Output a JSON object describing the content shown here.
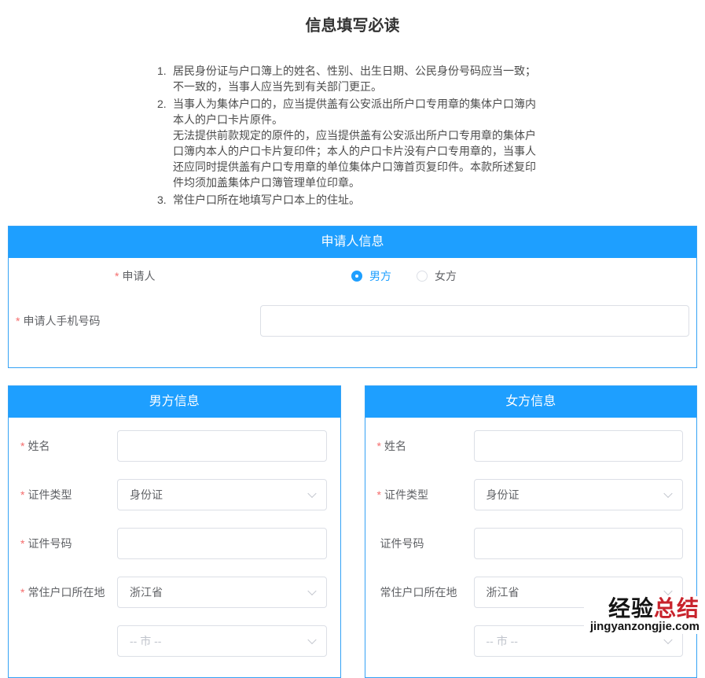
{
  "page": {
    "title": "信息填写必读"
  },
  "notice": {
    "items": [
      {
        "num": "1.",
        "p1": "居民身份证与户口簿上的姓名、性别、出生日期、公民身份号码应当一致；不一致的，当事人应当先到有关部门更正。"
      },
      {
        "num": "2.",
        "p1": "当事人为集体户口的，应当提供盖有公安派出所户口专用章的集体户口簿内本人的户口卡片原件。",
        "p2": "无法提供前款规定的原件的，应当提供盖有公安派出所户口专用章的集体户口簿内本人的户口卡片复印件；本人的户口卡片没有户口专用章的，当事人还应同时提供盖有户口专用章的单位集体户口簿首页复印件。本款所述复印件均须加盖集体户口簿管理单位印章。"
      },
      {
        "num": "3.",
        "p1": "常住户口所在地填写户口本上的住址。"
      }
    ]
  },
  "applicant": {
    "header": "申请人信息",
    "label": "申请人",
    "label_req": "*",
    "radio_male": "男方",
    "radio_female": "女方",
    "radio_selected": "男方",
    "phone_label": "申请人手机号码",
    "phone_req": "*",
    "phone_value": ""
  },
  "male": {
    "header": "男方信息",
    "name_label": "姓名",
    "name_req": "*",
    "name_value": "",
    "cert_type_label": "证件类型",
    "cert_type_req": "*",
    "cert_type_value": "身份证",
    "cert_no_label": "证件号码",
    "cert_no_req": "*",
    "cert_no_value": "",
    "residence_label": "常住户口所在地",
    "residence_req": "*",
    "residence_value": "浙江省",
    "city_placeholder": "-- 市 --"
  },
  "female": {
    "header": "女方信息",
    "name_label": "姓名",
    "name_req": "*",
    "name_value": "",
    "cert_type_label": "证件类型",
    "cert_type_req": "*",
    "cert_type_value": "身份证",
    "cert_no_label": "证件号码",
    "cert_no_req": "",
    "cert_no_value": "",
    "residence_label": "常住户口所在地",
    "residence_req": "",
    "residence_value": "浙江省",
    "city_placeholder": "-- 市 --"
  },
  "watermark": {
    "text_black": "经验",
    "text_red": "总结",
    "site": "jingyanzongjie.com"
  },
  "colors": {
    "accent_blue": "#1E9FFF",
    "required_red": "#F56C6C",
    "watermark_red": "#C8232C",
    "input_border": "#DCDFE6"
  }
}
